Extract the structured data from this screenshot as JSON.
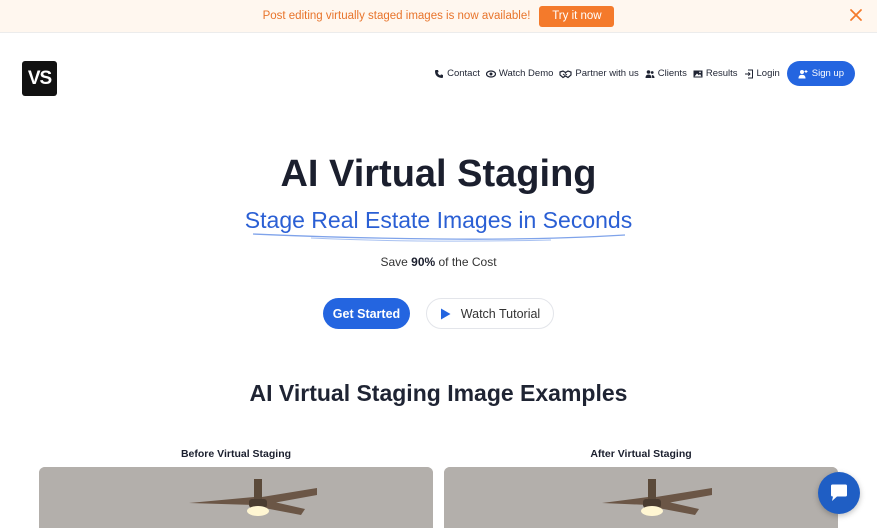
{
  "banner": {
    "text": "Post editing virtually staged images is now available!",
    "cta_label": "Try it now",
    "close_icon": "close-icon"
  },
  "header": {
    "logo_text": "VS",
    "nav": [
      {
        "label": "Contact",
        "icon": "phone-icon"
      },
      {
        "label": "Watch Demo",
        "icon": "eye-icon"
      },
      {
        "label": "Partner with us",
        "icon": "handshake-icon"
      },
      {
        "label": "Clients",
        "icon": "users-icon"
      },
      {
        "label": "Results",
        "icon": "image-icon"
      },
      {
        "label": "Login",
        "icon": "login-icon"
      }
    ],
    "signup_label": "Sign up",
    "signup_icon": "user-plus-icon"
  },
  "hero": {
    "title": "AI Virtual Staging",
    "subtitle": "Stage Real Estate Images in Seconds",
    "save_prefix": "Save ",
    "save_value": "90%",
    "save_suffix": " of the Cost",
    "primary_cta": "Get Started",
    "secondary_cta": "Watch Tutorial"
  },
  "examples": {
    "title": "AI Virtual Staging Image Examples",
    "before_label": "Before Virtual Staging",
    "after_label": "After Virtual Staging"
  },
  "colors": {
    "banner_accent": "#f47a2b",
    "brand_blue": "#2465e0",
    "subtitle_blue": "#2a5fd4"
  }
}
